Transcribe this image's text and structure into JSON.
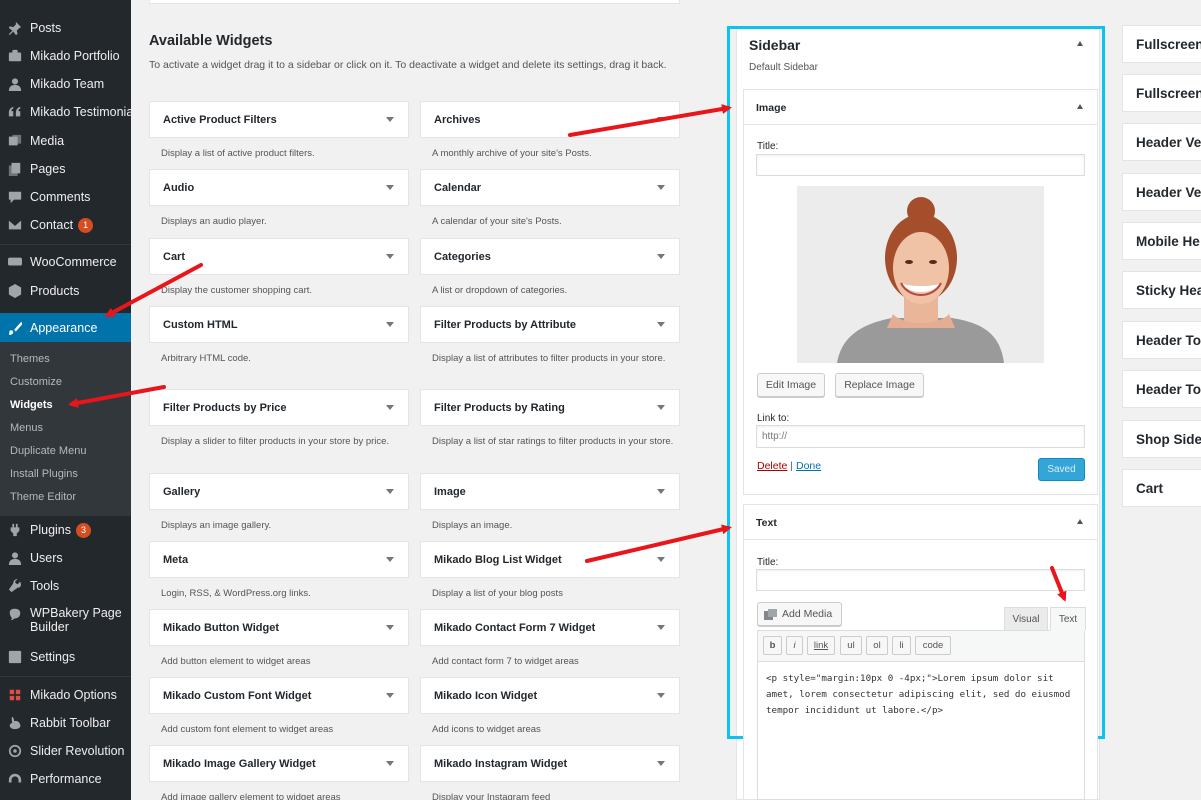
{
  "sidebar": {
    "items": [
      {
        "label": "Posts",
        "icon": "pin-icon"
      },
      {
        "label": "Mikado Portfolio",
        "icon": "portfolio-icon"
      },
      {
        "label": "Mikado Team",
        "icon": "user-icon"
      },
      {
        "label": "Mikado Testimonials",
        "icon": "quote-icon"
      },
      {
        "label": "Media",
        "icon": "media-icon"
      },
      {
        "label": "Pages",
        "icon": "pages-icon"
      },
      {
        "label": "Comments",
        "icon": "comments-icon"
      },
      {
        "label": "Contact",
        "icon": "envelope-icon",
        "badge": "1"
      },
      {
        "label": "WooCommerce",
        "icon": "woocommerce-icon"
      },
      {
        "label": "Products",
        "icon": "archive-icon"
      },
      {
        "label": "Appearance",
        "icon": "brush-icon"
      },
      {
        "label": "Plugins",
        "icon": "plugin-icon",
        "badge": "3"
      },
      {
        "label": "Users",
        "icon": "users-icon"
      },
      {
        "label": "Tools",
        "icon": "wrench-icon"
      },
      {
        "label": "WPBakery Page Builder",
        "icon": "wpbakery-icon"
      },
      {
        "label": "Settings",
        "icon": "settings-icon"
      },
      {
        "label": "Mikado Options",
        "icon": "mikado-options-icon"
      },
      {
        "label": "Rabbit Toolbar",
        "icon": "rabbit-icon"
      },
      {
        "label": "Slider Revolution",
        "icon": "slider-icon"
      },
      {
        "label": "Performance",
        "icon": "performance-icon"
      }
    ],
    "submenu": [
      "Themes",
      "Customize",
      "Widgets",
      "Menus",
      "Duplicate Menu",
      "Install Plugins",
      "Theme Editor"
    ],
    "active_color": "#0073aa",
    "bg_color": "#23282d"
  },
  "available": {
    "title": "Available Widgets",
    "description": "To activate a widget drag it to a sidebar or click on it. To deactivate a widget and delete its settings, drag it back.",
    "widgets": [
      {
        "name": "Active Product Filters",
        "desc": "Display a list of active product filters."
      },
      {
        "name": "Archives",
        "desc": "A monthly archive of your site's Posts."
      },
      {
        "name": "Audio",
        "desc": "Displays an audio player."
      },
      {
        "name": "Calendar",
        "desc": "A calendar of your site's Posts."
      },
      {
        "name": "Cart",
        "desc": "Display the customer shopping cart."
      },
      {
        "name": "Categories",
        "desc": "A list or dropdown of categories."
      },
      {
        "name": "Custom HTML",
        "desc": "Arbitrary HTML code."
      },
      {
        "name": "Filter Products by Attribute",
        "desc": "Display a list of attributes to filter products in your store."
      },
      {
        "name": "Filter Products by Price",
        "desc": "Display a slider to filter products in your store by price."
      },
      {
        "name": "Filter Products by Rating",
        "desc": "Display a list of star ratings to filter products in your store."
      },
      {
        "name": "Gallery",
        "desc": "Displays an image gallery."
      },
      {
        "name": "Image",
        "desc": "Displays an image."
      },
      {
        "name": "Meta",
        "desc": "Login, RSS, & WordPress.org links."
      },
      {
        "name": "Mikado Blog List Widget",
        "desc": "Display a list of your blog posts"
      },
      {
        "name": "Mikado Button Widget",
        "desc": "Add button element to widget areas"
      },
      {
        "name": "Mikado Contact Form 7 Widget",
        "desc": "Add contact form 7 to widget areas"
      },
      {
        "name": "Mikado Custom Font Widget",
        "desc": "Add custom font element to widget areas"
      },
      {
        "name": "Mikado Icon Widget",
        "desc": "Add icons to widget areas"
      },
      {
        "name": "Mikado Image Gallery Widget",
        "desc": "Add image gallery element to widget areas"
      },
      {
        "name": "Mikado Instagram Widget",
        "desc": "Display your Instagram feed"
      }
    ]
  },
  "sidebar_area": {
    "title": "Sidebar",
    "subtitle": "Default Sidebar",
    "outline_color": "#0bc3ef",
    "image_widget": {
      "title": "Image",
      "title_label": "Title:",
      "edit_image": "Edit Image",
      "replace_image": "Replace Image",
      "link_label": "Link to:",
      "link_placeholder": "http://",
      "delete": "Delete",
      "separator": "|",
      "done": "Done",
      "saved": "Saved"
    },
    "text_widget": {
      "title": "Text",
      "title_label": "Title:",
      "add_media": "Add Media",
      "tab_visual": "Visual",
      "tab_text": "Text",
      "quicktags": [
        "b",
        "i",
        "link",
        "ul",
        "ol",
        "li",
        "code"
      ],
      "content": "<p style=\"margin:10px 0 -4px;\">Lorem ipsum dolor sit amet, lorem consectetur adipiscing elit, sed do eiusmod tempor incididunt ut labore.</p>"
    }
  },
  "right_areas": [
    "Fullscreen",
    "Fullscreen",
    "Header Ve",
    "Header Ve",
    "Mobile He",
    "Sticky Hea",
    "Header Top",
    "Header Top",
    "Shop Sideb",
    "Cart"
  ],
  "arrow_color": "#e8151b"
}
